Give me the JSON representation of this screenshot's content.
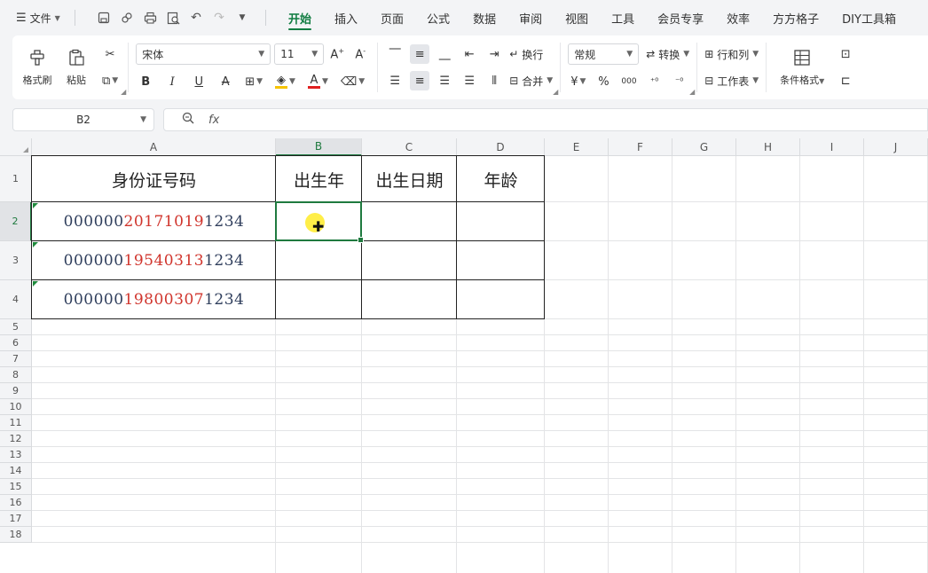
{
  "menubar": {
    "file_label": "文件",
    "tabs": [
      {
        "label": "开始",
        "active": true
      },
      {
        "label": "插入"
      },
      {
        "label": "页面"
      },
      {
        "label": "公式"
      },
      {
        "label": "数据"
      },
      {
        "label": "审阅"
      },
      {
        "label": "视图"
      },
      {
        "label": "工具"
      },
      {
        "label": "会员专享"
      },
      {
        "label": "效率"
      },
      {
        "label": "方方格子"
      },
      {
        "label": "DIY工具箱"
      }
    ]
  },
  "ribbon": {
    "format_painter": "格式刷",
    "paste": "粘贴",
    "font_name": "宋体",
    "font_size": "11",
    "wrap_text": "换行",
    "merge": "合并",
    "number_format": "常规",
    "convert": "转换",
    "rows_cols": "行和列",
    "worksheet": "工作表",
    "conditional_format": "条件格式",
    "yen": "¥",
    "percent": "%",
    "thousands": "000",
    "font_color": "#e02020",
    "fill_color": "#f7c300",
    "accent": "#107c41"
  },
  "formula_bar": {
    "name_box": "B2",
    "fx_label": "fx",
    "content": ""
  },
  "sheet": {
    "columns": [
      "A",
      "B",
      "C",
      "D",
      "E",
      "F",
      "G",
      "H",
      "I",
      "J"
    ],
    "selected_column": "B",
    "rows": [
      "1",
      "2",
      "3",
      "4",
      "5",
      "6",
      "7",
      "8",
      "9",
      "10",
      "11",
      "12",
      "13",
      "14",
      "15",
      "16",
      "17",
      "18"
    ],
    "selected_row": "2",
    "headers": [
      "身份证号码",
      "出生年",
      "出生日期",
      "年龄"
    ],
    "id_numbers": [
      {
        "prefix": "000000",
        "date": "20171019",
        "suffix": "1234"
      },
      {
        "prefix": "000000",
        "date": "19540313",
        "suffix": "1234"
      },
      {
        "prefix": "000000",
        "date": "19800307",
        "suffix": "1234"
      }
    ],
    "active_cell": "B2"
  }
}
